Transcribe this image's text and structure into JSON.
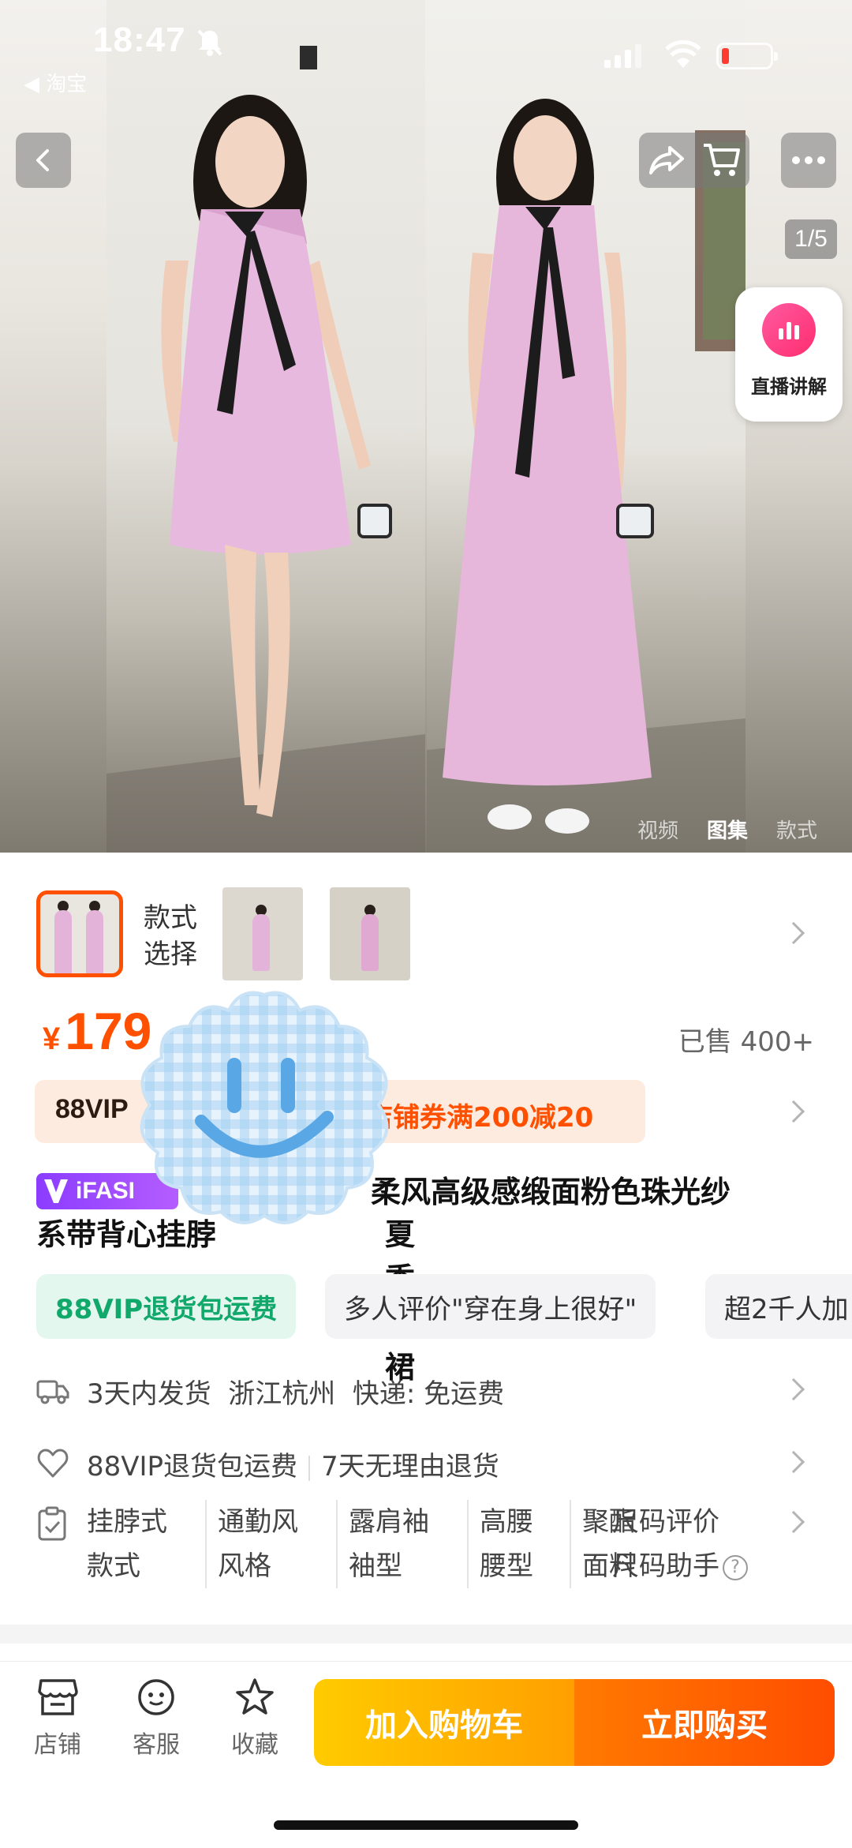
{
  "status": {
    "time": "18:47",
    "back_app": "◀ 淘宝"
  },
  "gallery": {
    "counter": "1/5",
    "live_label": "直播讲解",
    "tabs": [
      "视频",
      "图集",
      "款式"
    ]
  },
  "style_selector": {
    "label_line1": "款式",
    "label_line2": "选择"
  },
  "price": {
    "currency": "¥",
    "value": "179",
    "sold": "已售 400+"
  },
  "promo": {
    "vip": "88VIP",
    "coupon": "店铺券满200减20"
  },
  "title": {
    "brand": "iFASI",
    "line1": "柔风高级感缎面粉色珠光纱",
    "line2a": "系带背心挂脖",
    "line2b": "夏季长裙"
  },
  "tags": [
    "88VIP退货包运费",
    "多人评价\"穿在身上很好\"",
    "超2千人加"
  ],
  "shipping": {
    "text": "3天内发货  浙江杭州  快递: 免运费"
  },
  "service": {
    "a": "88VIP退货包运费",
    "b": "7天无理由退货"
  },
  "attributes": [
    {
      "value": "挂脖式",
      "key": "款式"
    },
    {
      "value": "通勤风",
      "key": "风格"
    },
    {
      "value": "露肩袖",
      "key": "袖型"
    },
    {
      "value": "高腰",
      "key": "腰型"
    },
    {
      "value": "聚酯",
      "key": "面料"
    }
  ],
  "size": {
    "line1": "尺码评价",
    "line2": "尺码助手"
  },
  "bottom_bar": {
    "shop": "店铺",
    "service": "客服",
    "favorite": "收藏",
    "add_cart": "加入购物车",
    "buy_now": "立即购买"
  },
  "colors": {
    "accent": "#ff5000",
    "green": "#11a86b",
    "purple": "#8b3cff"
  }
}
